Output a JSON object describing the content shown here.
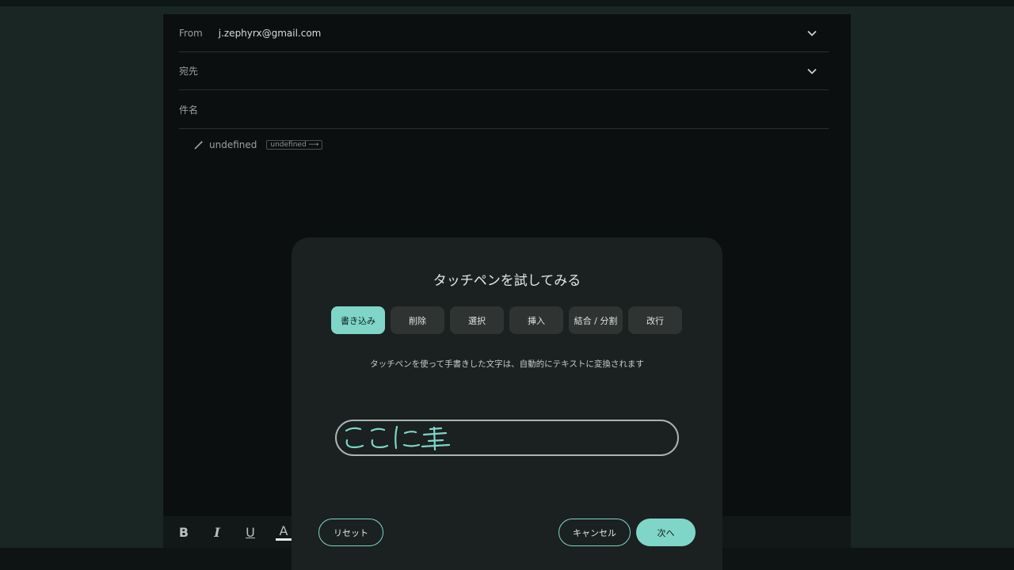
{
  "compose": {
    "from_label": "From",
    "from_value": "j.zephyrx@gmail.com",
    "to_label": "宛先",
    "subject_label": "件名",
    "signature_text": "undefined",
    "signature_chip": "undefined ⟶"
  },
  "toolbar": {
    "bold": "B",
    "italic": "I",
    "underline": "U",
    "text_color": "A"
  },
  "dialog": {
    "title": "タッチペンを試してみる",
    "tabs": [
      "書き込み",
      "削除",
      "選択",
      "挿入",
      "結合 / 分割",
      "改行"
    ],
    "active_tab": "書き込み",
    "description": "タッチペンを使って手書きした文字は、自動的にテキストに変換されます",
    "handwriting": "ここに書",
    "reset_button": "リセット",
    "cancel_button": "キャンセル",
    "next_button": "次へ"
  },
  "colors": {
    "accent": "#7fd6c8",
    "dialog_bg": "#1b2020",
    "compose_bg": "#0b0f0f"
  }
}
